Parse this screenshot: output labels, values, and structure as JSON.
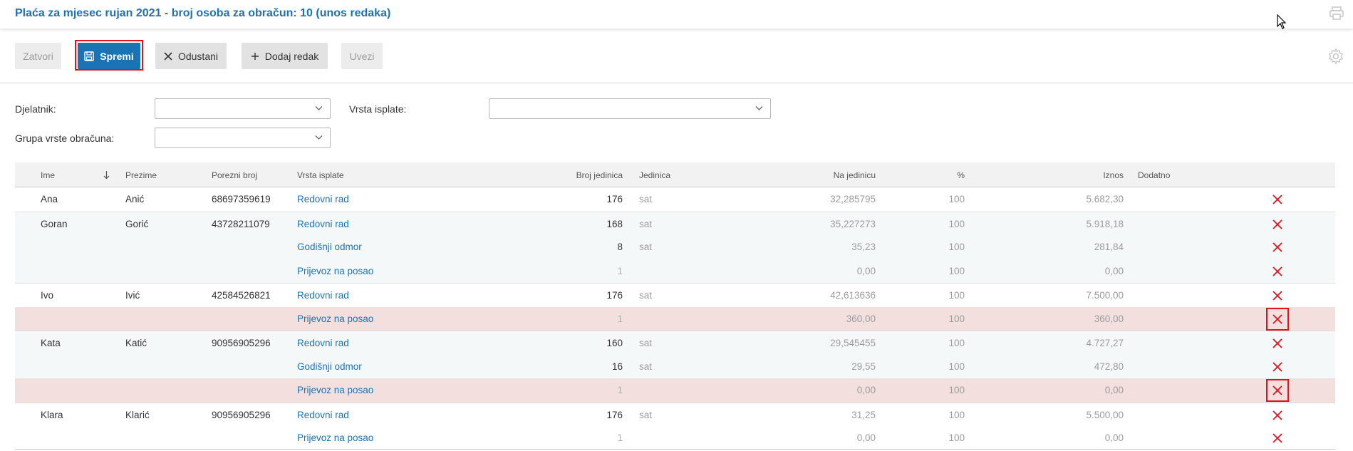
{
  "header": {
    "title": "Plaća za mjesec rujan 2021 - broj osoba za obračun: 10 (unos redaka)"
  },
  "toolbar": {
    "close_label": "Zatvori",
    "save_label": "Spremi",
    "cancel_label": "Odustani",
    "add_row_label": "Dodaj redak",
    "import_label": "Uvezi"
  },
  "filters": {
    "employee_label": "Djelatnik:",
    "employee_value": "",
    "payment_type_label": "Vrsta isplate:",
    "payment_type_value": "",
    "calc_group_label": "Grupa vrste obračuna:",
    "calc_group_value": ""
  },
  "table": {
    "columns": {
      "ime": "Ime",
      "prezime": "Prezime",
      "oib": "Porezni broj",
      "vrsta": "Vrsta isplate",
      "broj": "Broj jedinica",
      "jedinica": "Jedinica",
      "na_jedinicu": "Na jedinicu",
      "postotak": "%",
      "iznos": "Iznos",
      "dodatno": "Dodatno"
    },
    "rows": [
      {
        "ime": "Ana",
        "prezime": "Anić",
        "oib": "68697359619",
        "vrsta": "Redovni rad",
        "broj": "176",
        "jedinica": "sat",
        "na_jedinicu": "32,285795",
        "postotak": "100",
        "iznos": "5.682,30"
      },
      {
        "ime": "Goran",
        "prezime": "Gorić",
        "oib": "43728211079",
        "vrsta": "Redovni rad",
        "broj": "168",
        "jedinica": "sat",
        "na_jedinicu": "35,227273",
        "postotak": "100",
        "iznos": "5.918,18"
      },
      {
        "ime": "",
        "prezime": "",
        "oib": "",
        "vrsta": "Godišnji odmor",
        "broj": "8",
        "jedinica": "sat",
        "na_jedinicu": "35,23",
        "postotak": "100",
        "iznos": "281,84"
      },
      {
        "ime": "",
        "prezime": "",
        "oib": "",
        "vrsta": "Prijevoz na posao",
        "broj": "1",
        "jedinica": "",
        "na_jedinicu": "0,00",
        "postotak": "100",
        "iznos": "0,00"
      },
      {
        "ime": "Ivo",
        "prezime": "Ivić",
        "oib": "42584526821",
        "vrsta": "Redovni rad",
        "broj": "176",
        "jedinica": "sat",
        "na_jedinicu": "42,613636",
        "postotak": "100",
        "iznos": "7.500,00"
      },
      {
        "ime": "",
        "prezime": "",
        "oib": "",
        "vrsta": "Prijevoz na posao",
        "broj": "1",
        "jedinica": "",
        "na_jedinicu": "360,00",
        "postotak": "100",
        "iznos": "360,00"
      },
      {
        "ime": "Kata",
        "prezime": "Katić",
        "oib": "90956905296",
        "vrsta": "Redovni rad",
        "broj": "160",
        "jedinica": "sat",
        "na_jedinicu": "29,545455",
        "postotak": "100",
        "iznos": "4.727,27"
      },
      {
        "ime": "",
        "prezime": "",
        "oib": "",
        "vrsta": "Godišnji odmor",
        "broj": "16",
        "jedinica": "sat",
        "na_jedinicu": "29,55",
        "postotak": "100",
        "iznos": "472,80"
      },
      {
        "ime": "",
        "prezime": "",
        "oib": "",
        "vrsta": "Prijevoz na posao",
        "broj": "1",
        "jedinica": "",
        "na_jedinicu": "0,00",
        "postotak": "100",
        "iznos": "0,00"
      },
      {
        "ime": "Klara",
        "prezime": "Klarić",
        "oib": "90956905296",
        "vrsta": "Redovni rad",
        "broj": "176",
        "jedinica": "sat",
        "na_jedinicu": "31,25",
        "postotak": "100",
        "iznos": "5.500,00"
      },
      {
        "ime": "",
        "prezime": "",
        "oib": "",
        "vrsta": "Prijevoz na posao",
        "broj": "1",
        "jedinica": "",
        "na_jedinicu": "0,00",
        "postotak": "100",
        "iznos": "0,00"
      }
    ]
  },
  "colors": {
    "accent": "#1c73b4",
    "delete": "#e0141e",
    "highlight_row": "#f2dfde"
  },
  "icons": {
    "save": "floppy-icon",
    "cancel": "close-icon",
    "add": "plus-icon",
    "delete": "delete-x-icon",
    "settings": "gear-icon",
    "print": "print-icon",
    "sort": "sort-arrow-icon"
  }
}
